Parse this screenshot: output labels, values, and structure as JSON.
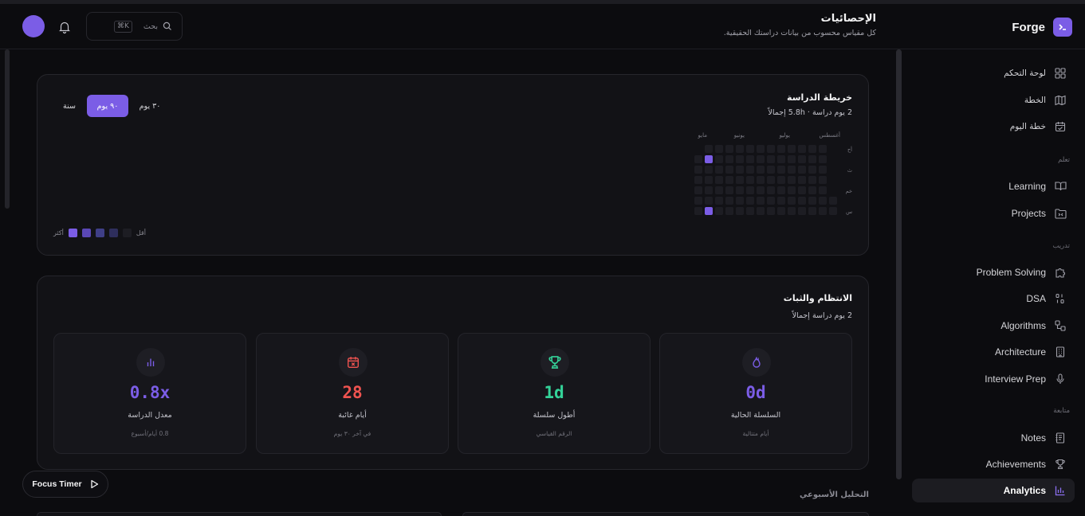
{
  "app": {
    "name": "Forge"
  },
  "header": {
    "title": "الإحصائيات",
    "subtitle": "كل مقياس محسوب من بيانات دراستك الحقيقية.",
    "search": {
      "placeholder": "بحث",
      "shortcut": "⌘K"
    }
  },
  "sidebar": {
    "items": [
      {
        "label": "لوحة التحكم",
        "icon": "dashboard-grid-icon"
      },
      {
        "label": "الخطة",
        "icon": "map-icon"
      },
      {
        "label": "خطة اليوم",
        "icon": "calendar-check-icon"
      }
    ],
    "sections": [
      {
        "title": "تعلم",
        "items": [
          {
            "label": "Learning",
            "icon": "book-open-icon"
          },
          {
            "label": "Projects",
            "icon": "folder-icon"
          }
        ]
      },
      {
        "title": "تدريب",
        "items": [
          {
            "label": "Problem Solving",
            "icon": "puzzle-icon"
          },
          {
            "label": "DSA",
            "icon": "data-structure-icon"
          },
          {
            "label": "Algorithms",
            "icon": "workflow-icon"
          },
          {
            "label": "Architecture",
            "icon": "building-icon"
          },
          {
            "label": "Interview Prep",
            "icon": "microphone-icon"
          }
        ]
      },
      {
        "title": "متابعة",
        "items": [
          {
            "label": "Notes",
            "icon": "notes-icon"
          },
          {
            "label": "Achievements",
            "icon": "trophy-icon"
          },
          {
            "label": "Analytics",
            "icon": "bar-chart-icon",
            "active": true
          }
        ]
      }
    ]
  },
  "heatmap": {
    "title": "خريطة الدراسة",
    "summary": "2 يوم دراسة · 5.8h إجمالاً",
    "ranges": [
      {
        "label": "٣٠ يوم",
        "active": false
      },
      {
        "label": "٩٠ يوم",
        "active": true
      },
      {
        "label": "سنة",
        "active": false
      }
    ],
    "months": [
      "أغسطس",
      "يوليو",
      "يونيو",
      "مايو"
    ],
    "day_labels": [
      "أح",
      "ث",
      "خم",
      "س"
    ],
    "active_cells": [
      [
        1,
        1
      ],
      [
        1,
        6
      ]
    ],
    "legend": {
      "less": "أقل",
      "more": "أكثر",
      "colors": [
        "#1d1d23",
        "#2e2e5c",
        "#3f3f87",
        "#5a47b5",
        "#7b5de6"
      ]
    }
  },
  "consistency": {
    "title": "الانتظام والثبات",
    "subtitle": "2 يوم دراسة إجمالاً",
    "stats": [
      {
        "value": "0d",
        "label": "السلسلة الحالية",
        "note": "أيام متتالية",
        "color": "#7b5de6",
        "icon": "flame-icon"
      },
      {
        "value": "1d",
        "label": "أطول سلسلة",
        "note": "الرقم القياسي",
        "color": "#34d399",
        "icon": "trophy-icon"
      },
      {
        "value": "28",
        "label": "أيام غائبة",
        "note": "في آخر ٣٠ يوم",
        "color": "#ef5350",
        "icon": "calendar-x-icon"
      },
      {
        "value": "0.8x",
        "label": "معدل الدراسة",
        "note": "0.8 أيام/أسبوع",
        "color": "#7b5de6",
        "icon": "bar-chart-icon"
      }
    ]
  },
  "weekly": {
    "title": "التحليل الأسبوعي"
  },
  "focus_timer": {
    "label": "Focus Timer"
  },
  "colors": {
    "accent": "#7b5de6",
    "success": "#34d399",
    "danger": "#ef5350"
  }
}
